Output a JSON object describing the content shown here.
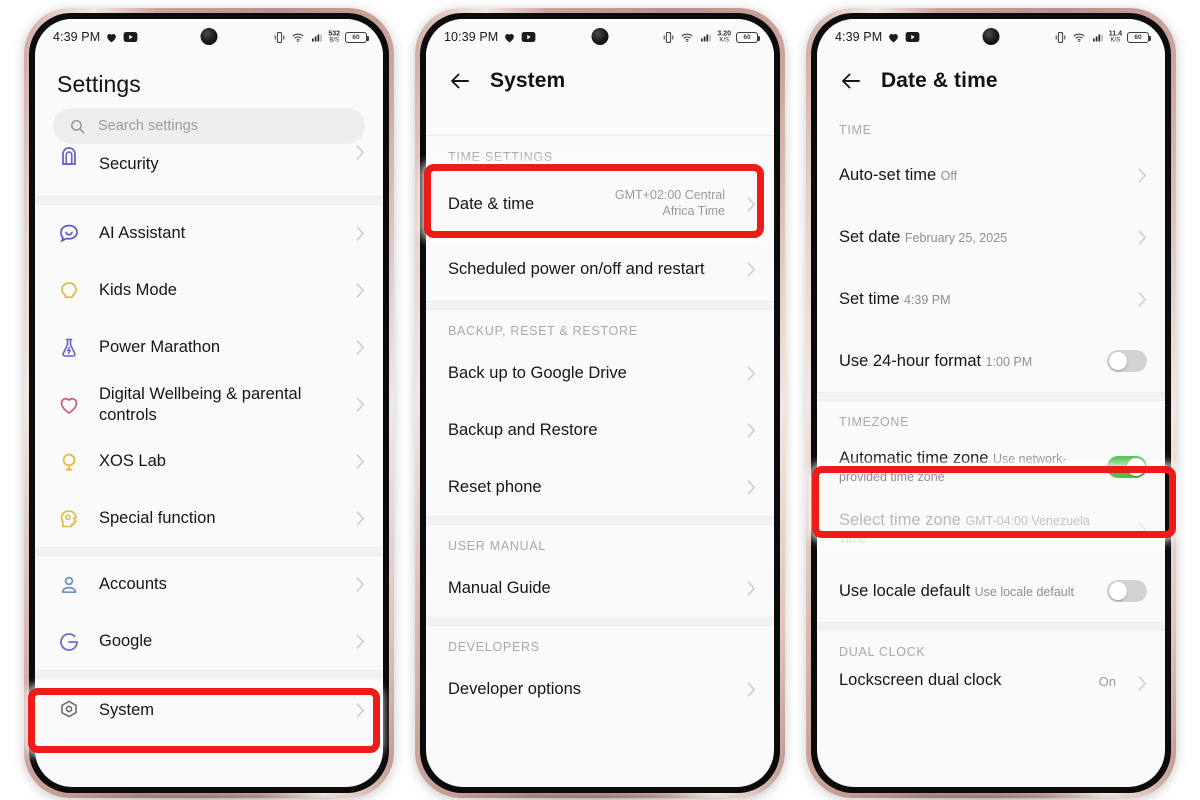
{
  "meta": {
    "accent_red": "#ee1c16",
    "toggle_on_color": "#4ec14e",
    "screen_bg": "#fafafa"
  },
  "phones": [
    {
      "id": "settings",
      "statusbar": {
        "time": "4:39 PM",
        "left_icons": [
          "heart-icon",
          "youtube-icon"
        ],
        "right_icons": [
          "vibrate-icon",
          "wifi-icon",
          "signal-icon"
        ],
        "net_speed_value": "532",
        "net_speed_unit": "B/S",
        "battery_level": "60"
      },
      "header": {
        "title": "Settings",
        "back": false
      },
      "search": {
        "placeholder": "Search settings",
        "icon": "search-icon"
      },
      "items": [
        {
          "type": "row",
          "icon": "security-icon",
          "label": "Security",
          "chevron": true,
          "partial_top": true
        },
        {
          "type": "gap"
        },
        {
          "type": "row",
          "icon": "ai-assistant-icon",
          "label": "AI Assistant",
          "chevron": true
        },
        {
          "type": "row",
          "icon": "kids-mode-icon",
          "label": "Kids Mode",
          "chevron": true
        },
        {
          "type": "row",
          "icon": "power-marathon-icon",
          "label": "Power Marathon",
          "chevron": true
        },
        {
          "type": "row",
          "icon": "digital-wellbeing-icon",
          "label": "Digital Wellbeing & parental controls",
          "chevron": true
        },
        {
          "type": "row",
          "icon": "xos-lab-icon",
          "label": "XOS Lab",
          "chevron": true
        },
        {
          "type": "row",
          "icon": "special-function-icon",
          "label": "Special function",
          "chevron": true
        },
        {
          "type": "gap"
        },
        {
          "type": "row",
          "icon": "accounts-icon",
          "label": "Accounts",
          "chevron": true
        },
        {
          "type": "row",
          "icon": "google-icon",
          "label": "Google",
          "chevron": true
        },
        {
          "type": "gap"
        },
        {
          "type": "row",
          "icon": "system-icon",
          "label": "System",
          "chevron": true,
          "highlighted": true
        }
      ]
    },
    {
      "id": "system",
      "statusbar": {
        "time": "10:39 PM",
        "left_icons": [
          "heart-icon",
          "youtube-icon"
        ],
        "right_icons": [
          "vibrate-icon",
          "wifi-icon",
          "signal-icon"
        ],
        "net_speed_value": "3.20",
        "net_speed_unit": "K/S",
        "battery_level": "60"
      },
      "header": {
        "title": "System",
        "back": true
      },
      "items": [
        {
          "type": "divider"
        },
        {
          "type": "caption",
          "label": "TIME SETTINGS"
        },
        {
          "type": "row",
          "label": "Date & time",
          "value": "GMT+02:00 Central Africa Time",
          "chevron": true,
          "highlighted": true
        },
        {
          "type": "row",
          "label": "Scheduled power on/off and restart",
          "chevron": true
        },
        {
          "type": "gap"
        },
        {
          "type": "caption",
          "label": "BACKUP, RESET & RESTORE"
        },
        {
          "type": "row",
          "label": "Back up to Google Drive",
          "chevron": true
        },
        {
          "type": "row",
          "label": "Backup and Restore",
          "chevron": true
        },
        {
          "type": "row",
          "label": "Reset phone",
          "chevron": true
        },
        {
          "type": "gap"
        },
        {
          "type": "caption",
          "label": "USER MANUAL"
        },
        {
          "type": "row",
          "label": "Manual Guide",
          "chevron": true
        },
        {
          "type": "gap"
        },
        {
          "type": "caption",
          "label": "DEVELOPERS"
        },
        {
          "type": "row",
          "label": "Developer options",
          "chevron": true
        }
      ]
    },
    {
      "id": "datetime",
      "statusbar": {
        "time": "4:39 PM",
        "left_icons": [
          "heart-icon",
          "youtube-icon"
        ],
        "right_icons": [
          "vibrate-icon",
          "wifi-icon",
          "signal-icon"
        ],
        "net_speed_value": "11.4",
        "net_speed_unit": "K/S",
        "battery_level": "60"
      },
      "header": {
        "title": "Date & time",
        "back": true
      },
      "items": [
        {
          "type": "caption",
          "label": "TIME"
        },
        {
          "type": "row",
          "label": "Auto-set time",
          "sub": "Off",
          "chevron": true
        },
        {
          "type": "row",
          "label": "Set date",
          "sub": "February 25, 2025",
          "chevron": true
        },
        {
          "type": "row",
          "label": "Set time",
          "sub": "4:39 PM",
          "chevron": true
        },
        {
          "type": "row",
          "label": "Use 24-hour format",
          "sub": "1:00 PM",
          "toggle": "off"
        },
        {
          "type": "gap"
        },
        {
          "type": "caption",
          "label": "TIMEZONE"
        },
        {
          "type": "row",
          "label": "Automatic time zone",
          "sub": "Use network-provided time zone",
          "toggle": "on",
          "highlighted": true
        },
        {
          "type": "row",
          "label": "Select time zone",
          "sub": "GMT-04:00 Venezuela Time",
          "chevron": true,
          "dim": true
        },
        {
          "type": "row",
          "label": "Use locale default",
          "sub": "Use locale default",
          "toggle": "off"
        },
        {
          "type": "gap"
        },
        {
          "type": "caption",
          "label": "DUAL CLOCK"
        },
        {
          "type": "row",
          "label": "Lockscreen dual clock",
          "value": "On",
          "chevron": true,
          "clipped": true
        }
      ]
    }
  ],
  "highlights": [
    {
      "name": "system-row-highlight",
      "target": "System"
    },
    {
      "name": "date-time-row-highlight",
      "target": "Date & time"
    },
    {
      "name": "automatic-time-zone-highlight",
      "target": "Automatic time zone"
    }
  ]
}
